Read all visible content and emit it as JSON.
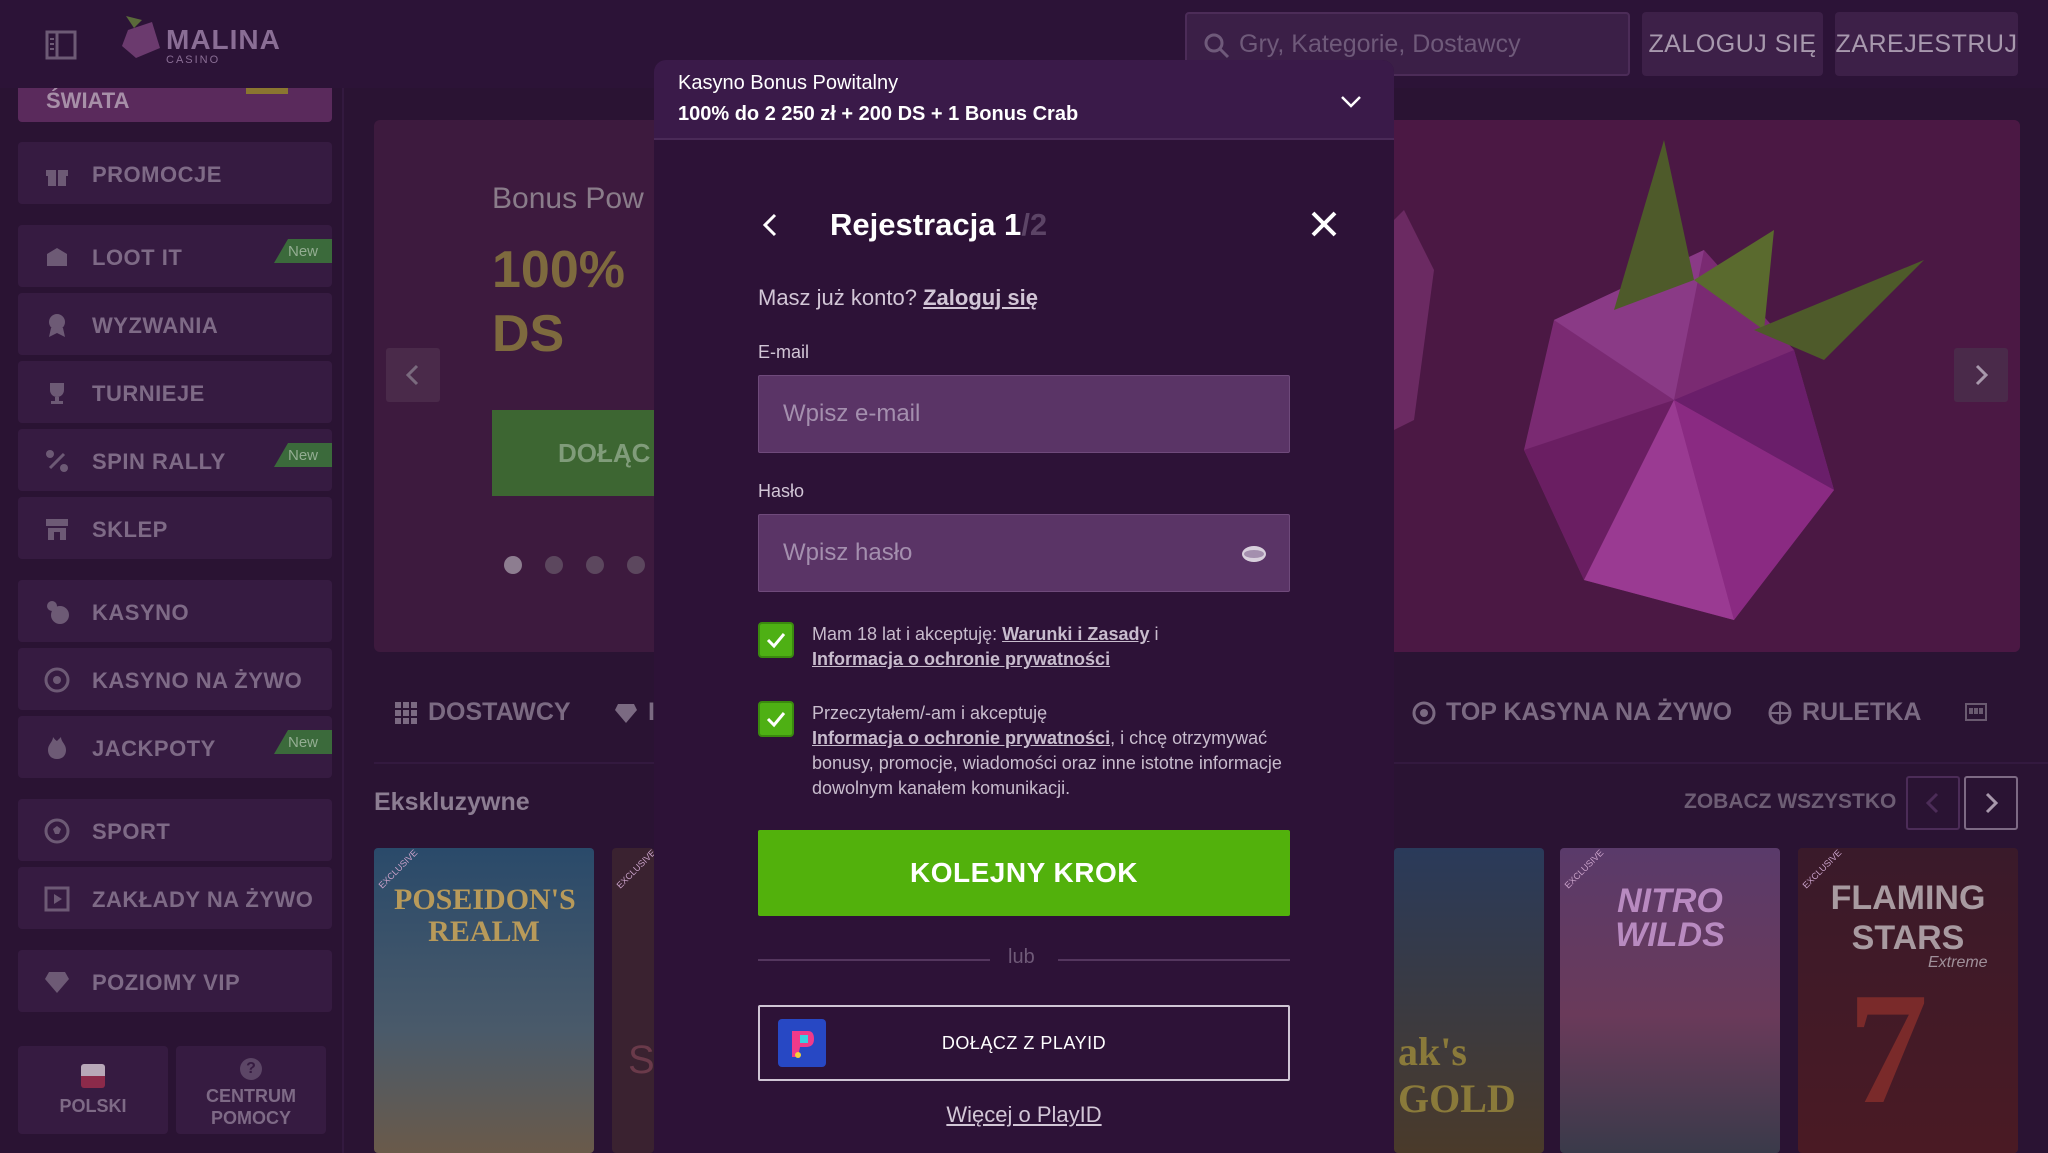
{
  "header": {
    "logo_text": "MALINA",
    "logo_sub": "CASINO",
    "search_placeholder": "Gry, Kategorie, Dostawcy",
    "login_label": "ZALOGUJ SIĘ",
    "register_label": "ZAREJESTRUJ"
  },
  "sidebar": {
    "top_item": "ŚWIATA",
    "items": [
      {
        "label": "PROMOCJE",
        "icon": "gift-icon"
      },
      {
        "label": "LOOT IT",
        "icon": "loot-box-icon",
        "badge": "New"
      },
      {
        "label": "WYZWANIA",
        "icon": "medal-icon"
      },
      {
        "label": "TURNIEJE",
        "icon": "trophy-icon"
      },
      {
        "label": "SPIN RALLY",
        "icon": "spin-rally-icon",
        "badge": "New"
      },
      {
        "label": "SKLEP",
        "icon": "shop-icon"
      },
      {
        "label": "KASYNO",
        "icon": "casino-icon"
      },
      {
        "label": "KASYNO NA ŻYWO",
        "icon": "roulette-icon"
      },
      {
        "label": "JACKPOTY",
        "icon": "jackpot-icon",
        "badge": "New"
      },
      {
        "label": "SPORT",
        "icon": "soccer-ball-icon"
      },
      {
        "label": "ZAKŁADY NA ŻYWO",
        "icon": "live-bet-icon"
      },
      {
        "label": "POZIOMY VIP",
        "icon": "diamond-icon"
      }
    ],
    "lang_label": "POLSKI",
    "help_label_1": "CENTRUM",
    "help_label_2": "POMOCY"
  },
  "hero": {
    "subtitle": "Bonus Pow",
    "title_line1": "100% ",
    "title_line2": "DS",
    "cta": "DOŁĄC"
  },
  "categories": [
    {
      "label": "DOSTAWCY",
      "icon": "grid-icon"
    },
    {
      "label": "I",
      "icon": "diamond-icon"
    },
    {
      "label": "TOP KASYNA NA ŻYWO",
      "icon": "chip-icon"
    },
    {
      "label": "RULETKA",
      "icon": "roulette-icon"
    }
  ],
  "games_section": {
    "title": "Ekskluzywne",
    "see_all": "ZOBACZ WSZYSTKO",
    "games": [
      {
        "title": "POSEIDON'S REALM",
        "tag": "EXCLUSIVE"
      },
      {
        "title": "S",
        "tag": "EXCLUSIVE"
      },
      {
        "title": "ak's GOLD",
        "tag": ""
      },
      {
        "title": "NITRO WILDS",
        "tag": "EXCLUSIVE"
      },
      {
        "title": "FLAMING STARS",
        "subtitle": "Extreme",
        "tag": "EXCLUSIVE"
      }
    ]
  },
  "modal": {
    "bonus_title": "Kasyno Bonus Powitalny",
    "bonus_desc": "100% do 2 250 zł + 200 DS + 1 Bonus Crab",
    "title": "Rejestracja 1",
    "step_total": "/2",
    "have_account": "Masz już konto?",
    "login_link": "Zaloguj się",
    "email_label": "E-mail",
    "email_placeholder": "Wpisz e-mail",
    "password_label": "Hasło",
    "password_placeholder": "Wpisz hasło",
    "check1_prefix": "Mam 18 lat i akceptuję: ",
    "check1_link1": "Warunki i Zasady",
    "check1_mid": " i",
    "check1_link2": "Informacja o ochronie prywatności",
    "check2_prefix": "Przeczytałem/-am i akceptuję",
    "check2_link": "Informacja o ochronie prywatności",
    "check2_suffix": ", i chcę otrzymywać bonusy, promocje, wiadomości oraz inne istotne informacje dowolnym kanałem komunikacji.",
    "next_button": "KOLEJNY KROK",
    "or_text": "lub",
    "playid_button": "DOŁĄCZ Z PLAYID",
    "more_playid": "Więcej o PlayID"
  },
  "colors": {
    "accent_green": "#52b10c",
    "modal_bg": "#2d1237",
    "page_bg": "#2a1333"
  }
}
